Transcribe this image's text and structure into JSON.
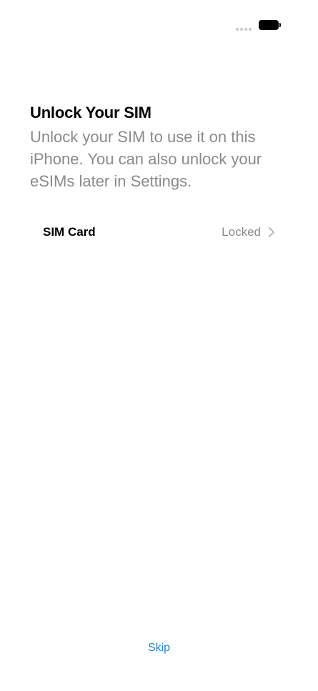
{
  "header": {
    "title": "Unlock Your SIM",
    "subtitle": "Unlock your SIM to use it on this iPhone. You can also unlock your eSIMs later in Settings."
  },
  "sim_row": {
    "label": "SIM Card",
    "status": "Locked"
  },
  "footer": {
    "skip_label": "Skip"
  },
  "icons": {
    "signal": "signal-dots-icon",
    "battery": "battery-icon",
    "chevron": "chevron-right-icon"
  },
  "colors": {
    "accent": "#1a83d6",
    "secondary_text": "#8a8a8e"
  }
}
